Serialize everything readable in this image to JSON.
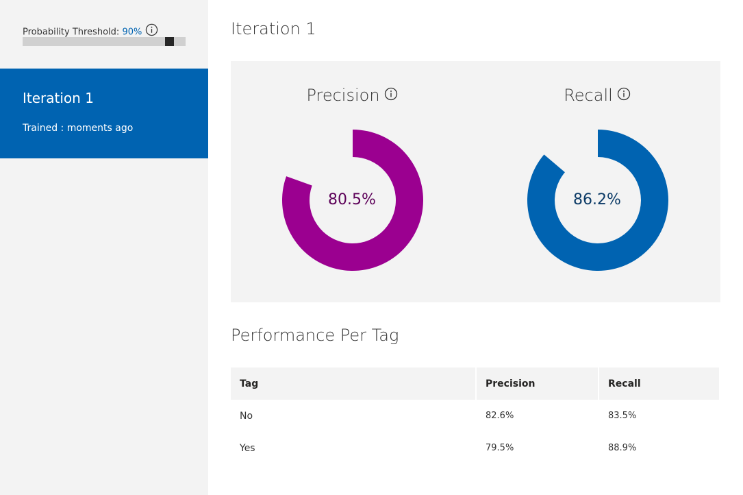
{
  "sidebar": {
    "threshold": {
      "label": "Probability Threshold:",
      "value_text": "90%",
      "value_fraction": 0.9
    },
    "iteration": {
      "title": "Iteration 1",
      "subtitle": "Trained : moments ago"
    }
  },
  "main": {
    "title": "Iteration 1",
    "metrics": [
      {
        "name": "Precision",
        "value_text": "80.5%",
        "value": 0.805,
        "color": "#9b0090",
        "text_color": "#5c0058"
      },
      {
        "name": "Recall",
        "value_text": "86.2%",
        "value": 0.862,
        "color": "#0063b1",
        "text_color": "#0b3a66"
      }
    ],
    "performance": {
      "title": "Performance Per Tag",
      "headers": {
        "tag": "Tag",
        "precision": "Precision",
        "recall": "Recall"
      },
      "rows": [
        {
          "tag": "No",
          "precision": "82.6%",
          "recall": "83.5%"
        },
        {
          "tag": "Yes",
          "precision": "79.5%",
          "recall": "88.9%"
        }
      ]
    }
  },
  "icons": {
    "info": "info-circle-icon"
  },
  "colors": {
    "accent": "#0063b1",
    "sidebar_bg": "#f3f3f3"
  }
}
